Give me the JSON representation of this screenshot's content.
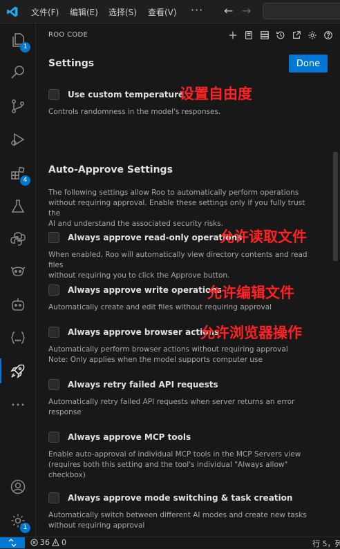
{
  "menu": [
    "文件(F)",
    "编辑(E)",
    "选择(S)",
    "查看(V)"
  ],
  "menu_more": "···",
  "panel": {
    "title": "ROO CODE",
    "settings_heading": "Settings",
    "done_label": "Done"
  },
  "temperature": {
    "label": "Use custom temperature",
    "desc": "Controls randomness in the model's responses."
  },
  "auto_approve": {
    "heading": "Auto-Approve Settings",
    "intro": "The following settings allow Roo to automatically perform operations\nwithout requiring approval. Enable these settings only if you fully trust the\nAI and understand the associated security risks."
  },
  "options": [
    {
      "label": "Always approve read-only operations",
      "desc": "When enabled, Roo will automatically view directory contents and read files\nwithout requiring you to click the Approve button."
    },
    {
      "label": "Always approve write operations",
      "desc": "Automatically create and edit files without requiring approval"
    },
    {
      "label": "Always approve browser actions",
      "desc": "Automatically perform browser actions without requiring approval\nNote: Only applies when the model supports computer use"
    },
    {
      "label": "Always retry failed API requests",
      "desc": "Automatically retry failed API requests when server returns an error\nresponse"
    },
    {
      "label": "Always approve MCP tools",
      "desc": "Enable auto-approval of individual MCP tools in the MCP Servers view\n(requires both this setting and the tool's individual \"Always allow\"\ncheckbox)"
    },
    {
      "label": "Always approve mode switching & task creation",
      "desc": "Automatically switch between different AI modes and create new tasks\nwithout requiring approval"
    }
  ],
  "annotations": {
    "temperature": "设置自由度",
    "read": "允许读取文件",
    "write": "允许编辑文件",
    "browser": "允许浏览器操作"
  },
  "badges": {
    "explorer": "1",
    "extensions": "4",
    "settings": "1"
  },
  "status": {
    "errors": "36",
    "warnings": "0",
    "position": "行 5，列"
  },
  "colors": {
    "accent": "#0078d4",
    "annotation": "#ff2222"
  }
}
